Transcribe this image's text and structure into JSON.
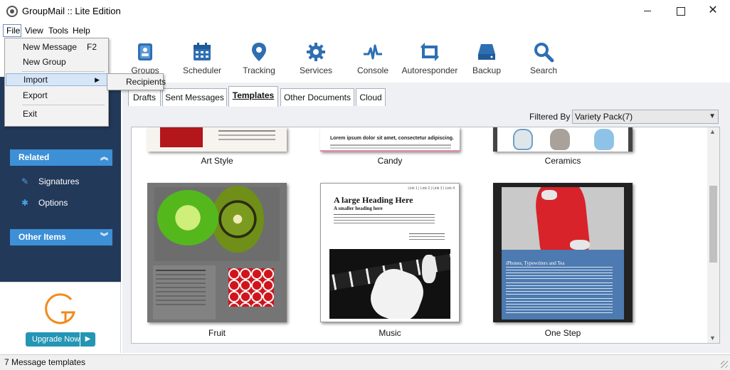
{
  "window": {
    "title": "GroupMail :: Lite Edition"
  },
  "menubar": {
    "file": "File",
    "view": "View",
    "tools": "Tools",
    "help": "Help"
  },
  "file_menu": {
    "new_message": "New Message",
    "new_message_shortcut": "F2",
    "new_group": "New Group",
    "import": "Import",
    "export": "Export",
    "exit": "Exit"
  },
  "import_submenu": {
    "recipients": "Recipients"
  },
  "toolbar": [
    {
      "label": "Groups",
      "icon": "groups-icon"
    },
    {
      "label": "Scheduler",
      "icon": "calendar-icon"
    },
    {
      "label": "Tracking",
      "icon": "location-pin-icon"
    },
    {
      "label": "Services",
      "icon": "gear-icon"
    },
    {
      "label": "Console",
      "icon": "pulse-icon"
    },
    {
      "label": "Autoresponder",
      "icon": "refresh-icon"
    },
    {
      "label": "Backup",
      "icon": "drive-icon"
    },
    {
      "label": "Search",
      "icon": "search-icon"
    }
  ],
  "sidebar": {
    "related": {
      "title": "Related",
      "items": [
        "Signatures",
        "Options"
      ]
    },
    "other_items": {
      "title": "Other Items"
    },
    "upgrade_label": "Upgrade Now"
  },
  "tabs": [
    "Drafts",
    "Sent Messages",
    "Templates",
    "Other Documents",
    "Cloud"
  ],
  "active_tab": "Templates",
  "filter": {
    "label": "Filtered By :",
    "value": "Variety Pack(7)"
  },
  "templates": [
    {
      "name": "Art Style"
    },
    {
      "name": "Candy",
      "preview_heading": "Lorem ipsum dolor sit amet, consectetur adipiscing."
    },
    {
      "name": "Ceramics"
    },
    {
      "name": "Fruit"
    },
    {
      "name": "Music",
      "preview_heading": "A large Heading Here",
      "preview_subheading": "A smaller heading here",
      "preview_nav": "Link 1 | Link 2 | Link 3 | Link 4"
    },
    {
      "name": "One Step",
      "preview_heading": "iPhones, Typewriters and Tea"
    }
  ],
  "status": {
    "text": "7 Message templates"
  },
  "colors": {
    "sidebar_bg": "#22395a",
    "accent": "#3d8fd6",
    "icon_blue": "#2e6fb3",
    "upgrade_orange": "#f28a1b",
    "upgrade_button": "#2595b4"
  }
}
